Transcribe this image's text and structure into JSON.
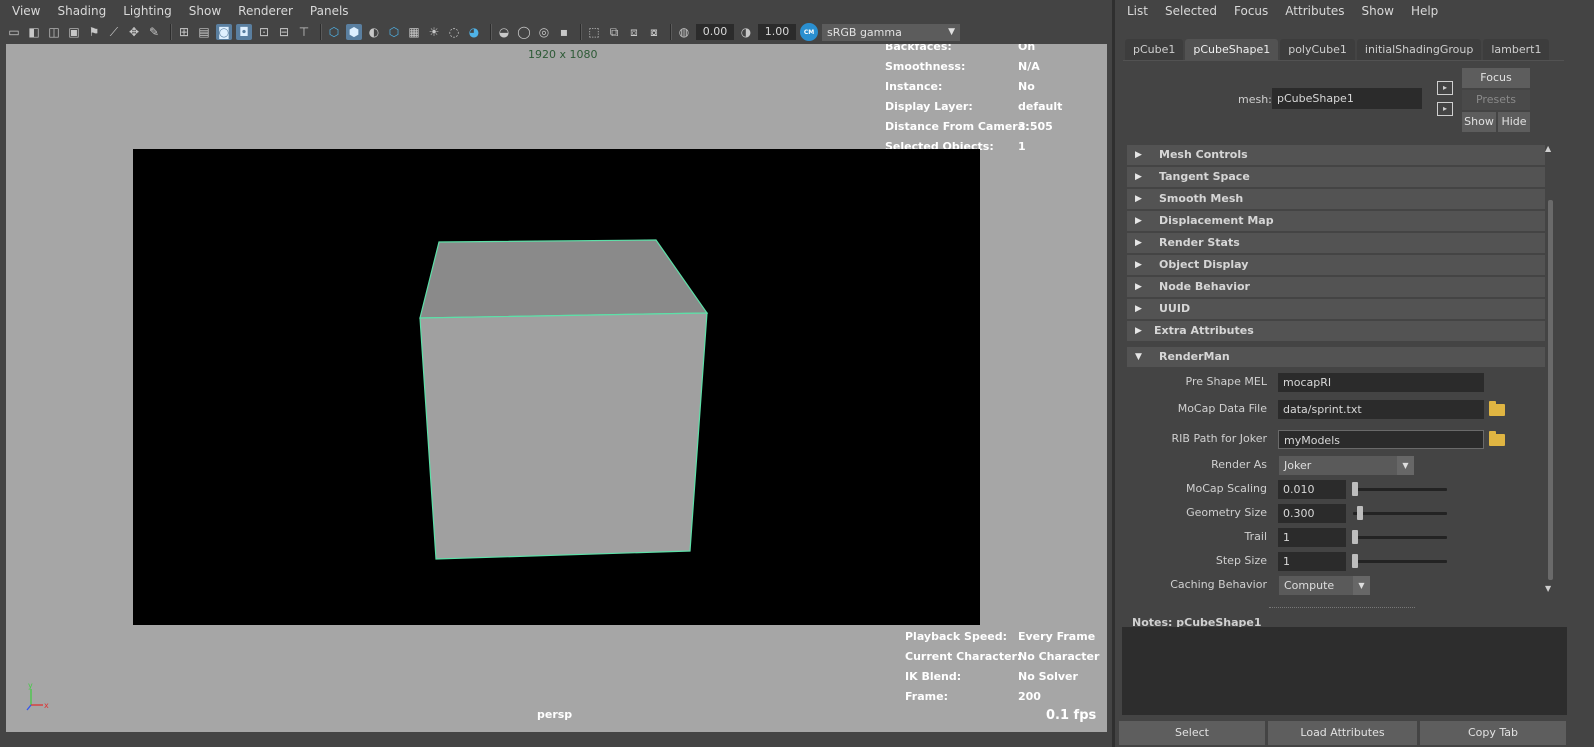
{
  "viewport": {
    "menu": [
      "View",
      "Shading",
      "Lighting",
      "Show",
      "Renderer",
      "Panels"
    ],
    "toolbar": {
      "value_a": "0.00",
      "value_b": "1.00",
      "color_space": "sRGB gamma",
      "color_mgmt_badge": "CM"
    },
    "resolution": "1920 x 1080",
    "hud_top": [
      {
        "label": "Backfaces:",
        "value": "On"
      },
      {
        "label": "Smoothness:",
        "value": "N/A"
      },
      {
        "label": "Instance:",
        "value": "No"
      },
      {
        "label": "Display Layer:",
        "value": "default"
      },
      {
        "label": "Distance From Camera:",
        "value": "3.505"
      },
      {
        "label": "Selected Objects:",
        "value": "1"
      }
    ],
    "hud_bottom": [
      {
        "label": "Playback Speed:",
        "value": "Every Frame"
      },
      {
        "label": "Current Character:",
        "value": "No Character"
      },
      {
        "label": "IK Blend:",
        "value": "No Solver"
      },
      {
        "label": "Frame:",
        "value": "200"
      }
    ],
    "camera": "persp",
    "fps": "0.1 fps",
    "axis": {
      "y": "y",
      "x": "x"
    },
    "colors": {
      "background": "#a6a6a6",
      "render_bg": "#000000",
      "wireframe": "#5de0a8",
      "resolution_text": "#2d5a36"
    }
  },
  "attr_editor": {
    "menu": [
      "List",
      "Selected",
      "Focus",
      "Attributes",
      "Show",
      "Help"
    ],
    "tabs": [
      "pCube1",
      "pCubeShape1",
      "polyCube1",
      "initialShadingGroup",
      "lambert1"
    ],
    "active_tab": 1,
    "mesh_label": "mesh:",
    "mesh_value": "pCubeShape1",
    "buttons": {
      "focus": "Focus",
      "presets": "Presets",
      "show": "Show",
      "hide": "Hide"
    },
    "sections": [
      "Mesh Controls",
      "Tangent Space",
      "Smooth Mesh",
      "Displacement Map",
      "Render Stats",
      "Object Display",
      "Node Behavior",
      "UUID",
      "Extra Attributes",
      "RenderMan"
    ],
    "renderman": {
      "pre_shape_mel": {
        "label": "Pre Shape MEL",
        "value": "mocapRI"
      },
      "mocap_data_file": {
        "label": "MoCap Data File",
        "value": "data/sprint.txt"
      },
      "rib_path": {
        "label": "RIB Path for Joker",
        "value": "myModels"
      },
      "render_as": {
        "label": "Render As",
        "value": "Joker"
      },
      "mocap_scaling": {
        "label": "MoCap Scaling",
        "value": "0.010"
      },
      "geometry_size": {
        "label": "Geometry Size",
        "value": "0.300"
      },
      "trail": {
        "label": "Trail",
        "value": "1"
      },
      "step_size": {
        "label": "Step Size",
        "value": "1"
      },
      "caching_behavior": {
        "label": "Caching Behavior",
        "value": "Compute"
      }
    },
    "notes_label": "Notes:  pCubeShape1",
    "bottom_buttons": [
      "Select",
      "Load Attributes",
      "Copy Tab"
    ]
  }
}
